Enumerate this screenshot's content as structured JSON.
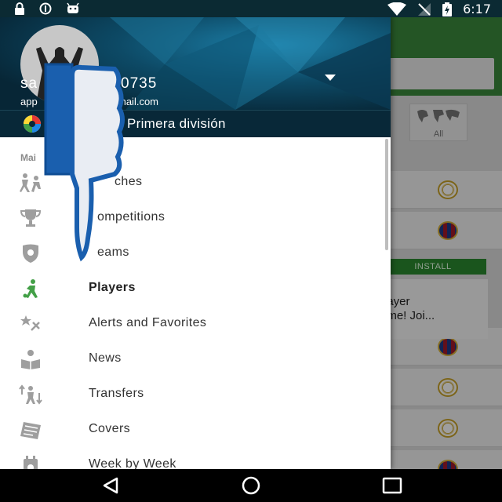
{
  "status_bar": {
    "time": "6:17",
    "icons": [
      "lock-icon",
      "sync-icon",
      "android-icon",
      "wifi-icon",
      "no-signal-icon",
      "battery-charging-icon"
    ]
  },
  "drawer": {
    "user": {
      "name_visible_start": "sa",
      "name_visible_end": "0735",
      "email_visible_start": "app",
      "email_visible_end": "mail.com"
    },
    "league": {
      "name": "Primera división"
    },
    "section_label": "Mai",
    "items": [
      {
        "label": "ches",
        "icon": "matches-icon"
      },
      {
        "label": "ompetitions",
        "icon": "trophy-icon"
      },
      {
        "label": "eams",
        "icon": "shield-icon"
      },
      {
        "label": "Players",
        "icon": "player-icon",
        "active": true
      },
      {
        "label": "Alerts and Favorites",
        "icon": "alerts-icon"
      },
      {
        "label": "News",
        "icon": "news-icon"
      },
      {
        "label": "Transfers",
        "icon": "transfers-icon"
      },
      {
        "label": "Covers",
        "icon": "covers-icon"
      },
      {
        "label": "Week by Week",
        "icon": "calendar-icon"
      }
    ]
  },
  "background_app": {
    "filter_label": "All",
    "install_label": "INSTALL",
    "ad_text_line1": "layer",
    "ad_text_line2": "ime! Joi..."
  },
  "nav_bar": {
    "buttons": [
      "back-button",
      "home-button",
      "recents-button"
    ]
  },
  "colors": {
    "accent_green": "#43a047",
    "header_blue": "#0d4a66"
  }
}
